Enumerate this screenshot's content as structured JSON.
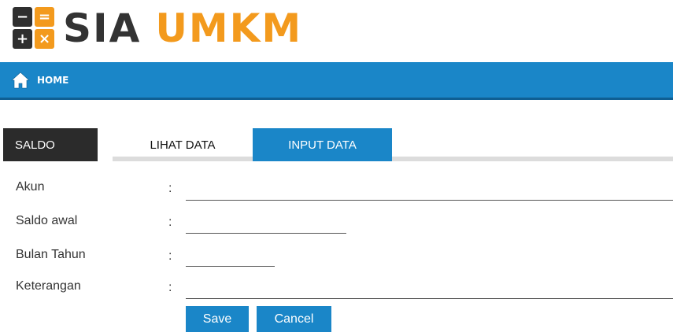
{
  "logo": {
    "text_main": "SIA",
    "text_accent": "UMKM",
    "icon_symbols": [
      "−",
      "=",
      "+",
      "×"
    ],
    "colors": {
      "dark": "#2f2f2f",
      "accent": "#f39a1d"
    }
  },
  "navbar": {
    "home_label": "HOME",
    "icon": "home-icon",
    "color": "#1a86c8"
  },
  "tabs": [
    {
      "label": "SALDO"
    },
    {
      "label": "LIHAT DATA"
    },
    {
      "label": "INPUT DATA",
      "active": true
    }
  ],
  "form": {
    "separator": ":",
    "fields": [
      {
        "label": "Akun",
        "value": ""
      },
      {
        "label": "Saldo awal",
        "value": ""
      },
      {
        "label": "Bulan Tahun",
        "value": ""
      },
      {
        "label": "Keterangan",
        "value": ""
      }
    ],
    "buttons": {
      "save": "Save",
      "cancel": "Cancel"
    }
  }
}
